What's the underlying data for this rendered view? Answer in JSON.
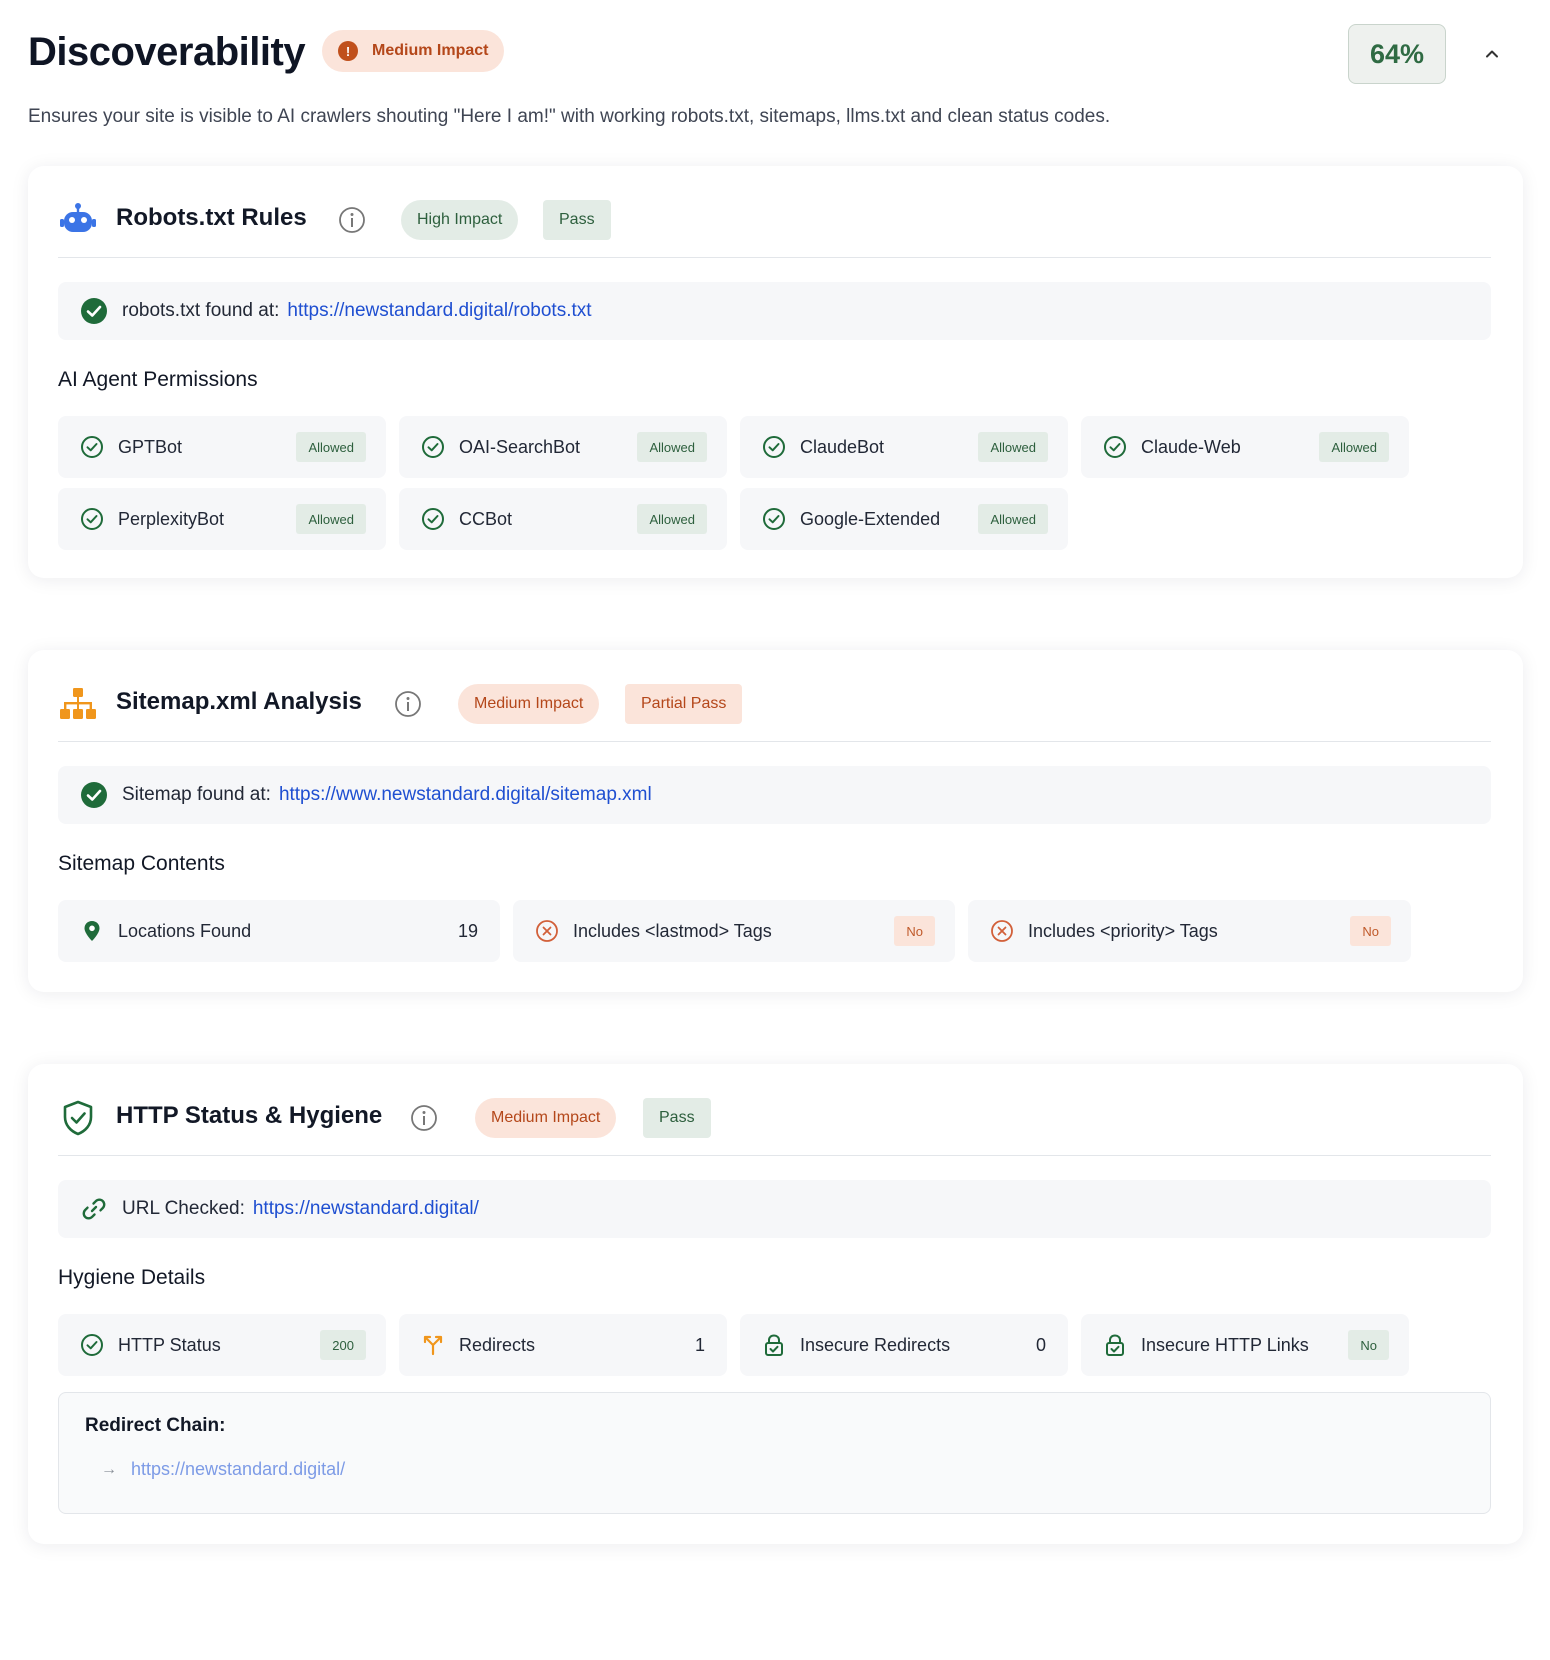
{
  "header": {
    "title": "Discoverability",
    "impact_label": "Medium Impact",
    "impact_icon": "!",
    "score": "64%",
    "description": "Ensures your site is visible to AI crawlers shouting \"Here I am!\" with working robots.txt, sitemaps, llms.txt and clean status codes."
  },
  "robots": {
    "title": "Robots.txt Rules",
    "impact": "High Impact",
    "status": "Pass",
    "found_label": "robots.txt found at:",
    "found_url": "https://newstandard.digital/robots.txt",
    "permissions_title": "AI Agent Permissions",
    "agents": [
      {
        "name": "GPTBot",
        "status": "Allowed"
      },
      {
        "name": "OAI-SearchBot",
        "status": "Allowed"
      },
      {
        "name": "ClaudeBot",
        "status": "Allowed"
      },
      {
        "name": "Claude-Web",
        "status": "Allowed"
      },
      {
        "name": "PerplexityBot",
        "status": "Allowed"
      },
      {
        "name": "CCBot",
        "status": "Allowed"
      },
      {
        "name": "Google-Extended",
        "status": "Allowed"
      }
    ]
  },
  "sitemap": {
    "title": "Sitemap.xml Analysis",
    "impact": "Medium Impact",
    "status": "Partial Pass",
    "found_label": "Sitemap found at:",
    "found_url": "https://www.newstandard.digital/sitemap.xml",
    "contents_title": "Sitemap Contents",
    "items": [
      {
        "name": "Locations Found",
        "value": "19"
      },
      {
        "name": "Includes <lastmod> Tags",
        "value": "No"
      },
      {
        "name": "Includes <priority> Tags",
        "value": "No"
      }
    ]
  },
  "http": {
    "title": "HTTP Status & Hygiene",
    "impact": "Medium Impact",
    "status": "Pass",
    "checked_label": "URL Checked:",
    "checked_url": "https://newstandard.digital/",
    "details_title": "Hygiene Details",
    "items": [
      {
        "name": "HTTP Status",
        "value": "200"
      },
      {
        "name": "Redirects",
        "value": "1"
      },
      {
        "name": "Insecure Redirects",
        "value": "0"
      },
      {
        "name": "Insecure HTTP Links",
        "value": "No"
      }
    ],
    "chain_title": "Redirect Chain:",
    "chain_arrow": "→",
    "chain": [
      "https://newstandard.digital/"
    ]
  },
  "colors": {
    "pass_green": "#2d5f3d",
    "impact_orange": "#b4471a",
    "link_blue": "#1f4fd1",
    "robot_blue": "#3b74e6",
    "sitemap_orange": "#f0961c"
  }
}
